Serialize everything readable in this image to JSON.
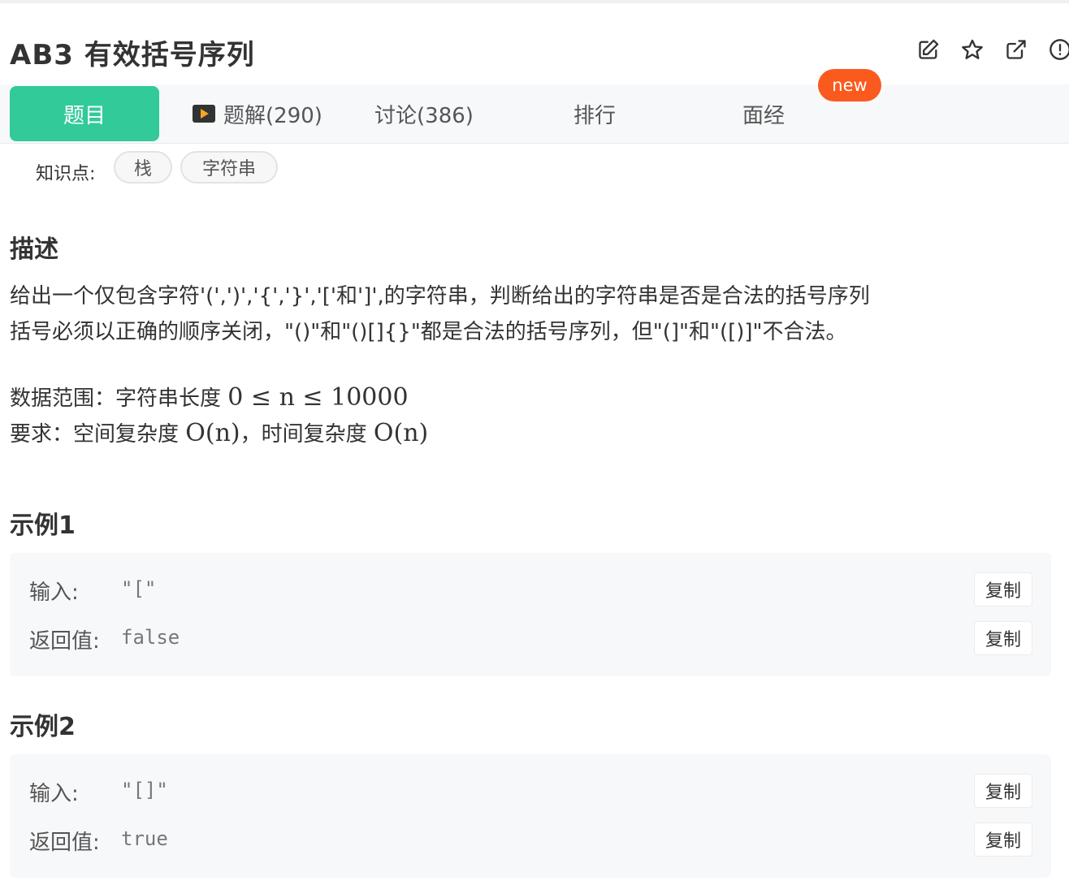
{
  "title": "AB3  有效括号序列",
  "header_icons": [
    "edit-icon",
    "star-icon",
    "share-icon",
    "report-icon"
  ],
  "tabs": [
    {
      "label": "题目",
      "active": true
    },
    {
      "label": "题解(290)",
      "icon": "video-icon"
    },
    {
      "label": "讨论(386)"
    },
    {
      "label": "排行"
    },
    {
      "label": "面经",
      "badge": "new"
    }
  ],
  "knowledge": {
    "label": "知识点:",
    "tags": [
      "栈",
      "字符串"
    ]
  },
  "description": {
    "heading": "描述",
    "line1": "给出一个仅包含字符'(',')','{','}','['和']',的字符串，判断给出的字符串是否是合法的括号序列",
    "line2": "括号必须以正确的顺序关闭，\"()\"和\"()[]{}\"都是合法的括号序列，但\"(]\"和\"([)]\"不合法。",
    "range_label": "数据范围：字符串长度",
    "range_math": "0 ≤ n ≤ 10000",
    "req_label": "要求：空间复杂度",
    "req_space": "O(n)",
    "req_sep": "，时间复杂度",
    "req_time": "O(n)"
  },
  "examples": [
    {
      "heading": "示例1",
      "input_label": "输入:",
      "input_value": "\"[\"",
      "output_label": "返回值:",
      "output_value": "false",
      "copy_label": "复制"
    },
    {
      "heading": "示例2",
      "input_label": "输入:",
      "input_value": "\"[]\"",
      "output_label": "返回值:",
      "output_value": "true",
      "copy_label": "复制"
    }
  ],
  "colors": {
    "accent": "#32ca99",
    "badge": "#fa5a1e"
  }
}
